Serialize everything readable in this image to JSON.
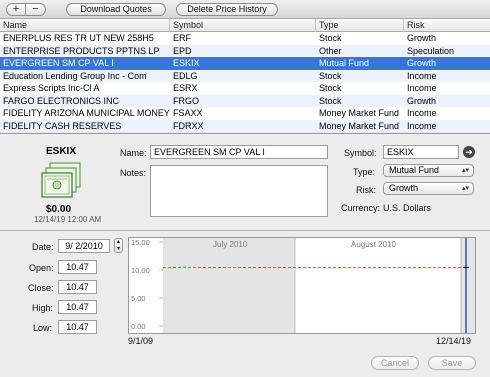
{
  "toolbar": {
    "add_label": "+",
    "remove_label": "−",
    "download_label": "Download Quotes",
    "delete_label": "Delete Price History"
  },
  "table": {
    "headers": [
      "Name",
      "Symbol",
      "Type",
      "Risk"
    ],
    "rows": [
      {
        "name": "ENERPLUS RES TR UT NEW 258H5",
        "symbol": "ERF",
        "type": "Stock",
        "risk": "Growth"
      },
      {
        "name": "ENTERPRISE PRODUCTS PPTNS LP",
        "symbol": "EPD",
        "type": "Other",
        "risk": "Speculation"
      },
      {
        "name": "EVERGREEN SM CP VAL I",
        "symbol": "ESKIX",
        "type": "Mutual Fund",
        "risk": "Growth"
      },
      {
        "name": "Education Lending Group Inc - Com",
        "symbol": "EDLG",
        "type": "Stock",
        "risk": "Income"
      },
      {
        "name": "Express Scripts Inc-Cl A",
        "symbol": "ESRX",
        "type": "Stock",
        "risk": "Income"
      },
      {
        "name": "FARGO ELECTRONICS INC",
        "symbol": "FRGO",
        "type": "Stock",
        "risk": "Growth"
      },
      {
        "name": "FIDELITY ARIZONA MUNICIPAL MONEY MKT",
        "symbol": "FSAXX",
        "type": "Money Market Fund",
        "risk": "Income"
      },
      {
        "name": "FIDELITY CASH RESERVES",
        "symbol": "FDRXX",
        "type": "Money Market Fund",
        "risk": "Income"
      }
    ],
    "selected_index": 2
  },
  "detail": {
    "symbol_title": "ESKIX",
    "value": "$0.00",
    "timestamp": "12/14/19 12:00 AM",
    "name_label": "Name:",
    "name_value": "EVERGREEN SM CP VAL I",
    "notes_label": "Notes:",
    "notes_value": "",
    "symbol_label": "Symbol:",
    "symbol_value": "ESKIX",
    "type_label": "Type:",
    "type_value": "Mutual Fund",
    "risk_label": "Risk:",
    "risk_value": "Growth",
    "currency_label": "Currency:",
    "currency_value": "U.S. Dollars"
  },
  "prices": {
    "date_label": "Date:",
    "date_value": "9/ 2/2010",
    "open_label": "Open:",
    "open_value": "10.47",
    "close_label": "Close:",
    "close_value": "10.47",
    "high_label": "High:",
    "high_value": "10.47",
    "low_label": "Low:",
    "low_value": "10.47"
  },
  "chart_data": {
    "type": "line",
    "title": "",
    "xlabel": "",
    "ylabel": "",
    "ylim": [
      0,
      15
    ],
    "yticks": [
      "15.00",
      "10.00",
      "5.00",
      "0.00"
    ],
    "period_labels": [
      "July 2010",
      "August 2010"
    ],
    "start_label": "9/1/09",
    "end_label": "12/14/19",
    "series": [
      {
        "values": [
          10.4,
          10.5,
          10.45,
          10.47,
          10.47,
          10.47
        ]
      }
    ]
  },
  "buttons": {
    "cancel_label": "Cancel",
    "save_label": "Save"
  },
  "colors": {
    "selection": "#3875d7",
    "line": "#3a6fd0"
  }
}
